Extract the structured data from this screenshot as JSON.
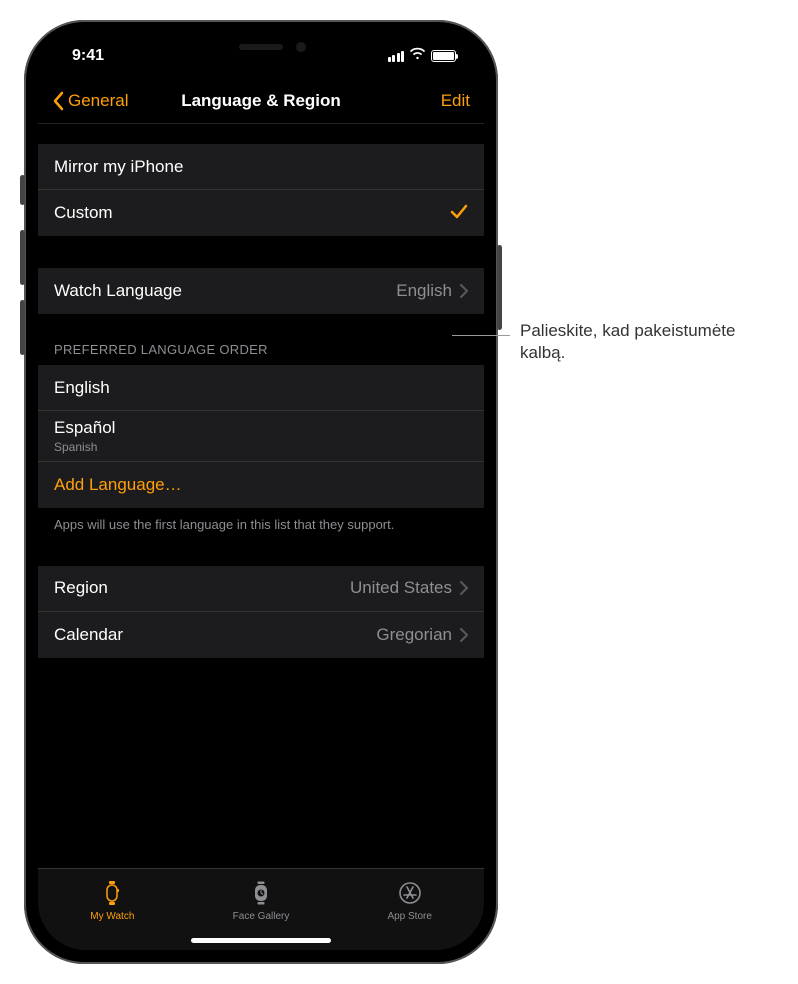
{
  "status": {
    "time": "9:41"
  },
  "nav": {
    "back": "General",
    "title": "Language & Region",
    "edit": "Edit"
  },
  "mirror_section": {
    "mirror": "Mirror my iPhone",
    "custom": "Custom"
  },
  "watch_lang": {
    "label": "Watch Language",
    "value": "English"
  },
  "pref_order": {
    "header": "PREFERRED LANGUAGE ORDER",
    "items": [
      {
        "title": "English",
        "sub": ""
      },
      {
        "title": "Español",
        "sub": "Spanish"
      }
    ],
    "add": "Add Language…",
    "footer": "Apps will use the first language in this list that they support."
  },
  "region_section": {
    "region": {
      "label": "Region",
      "value": "United States"
    },
    "calendar": {
      "label": "Calendar",
      "value": "Gregorian"
    }
  },
  "tabs": {
    "my_watch": "My Watch",
    "face_gallery": "Face Gallery",
    "app_store": "App Store"
  },
  "callout": "Palieskite, kad pakeistumėte kalbą."
}
